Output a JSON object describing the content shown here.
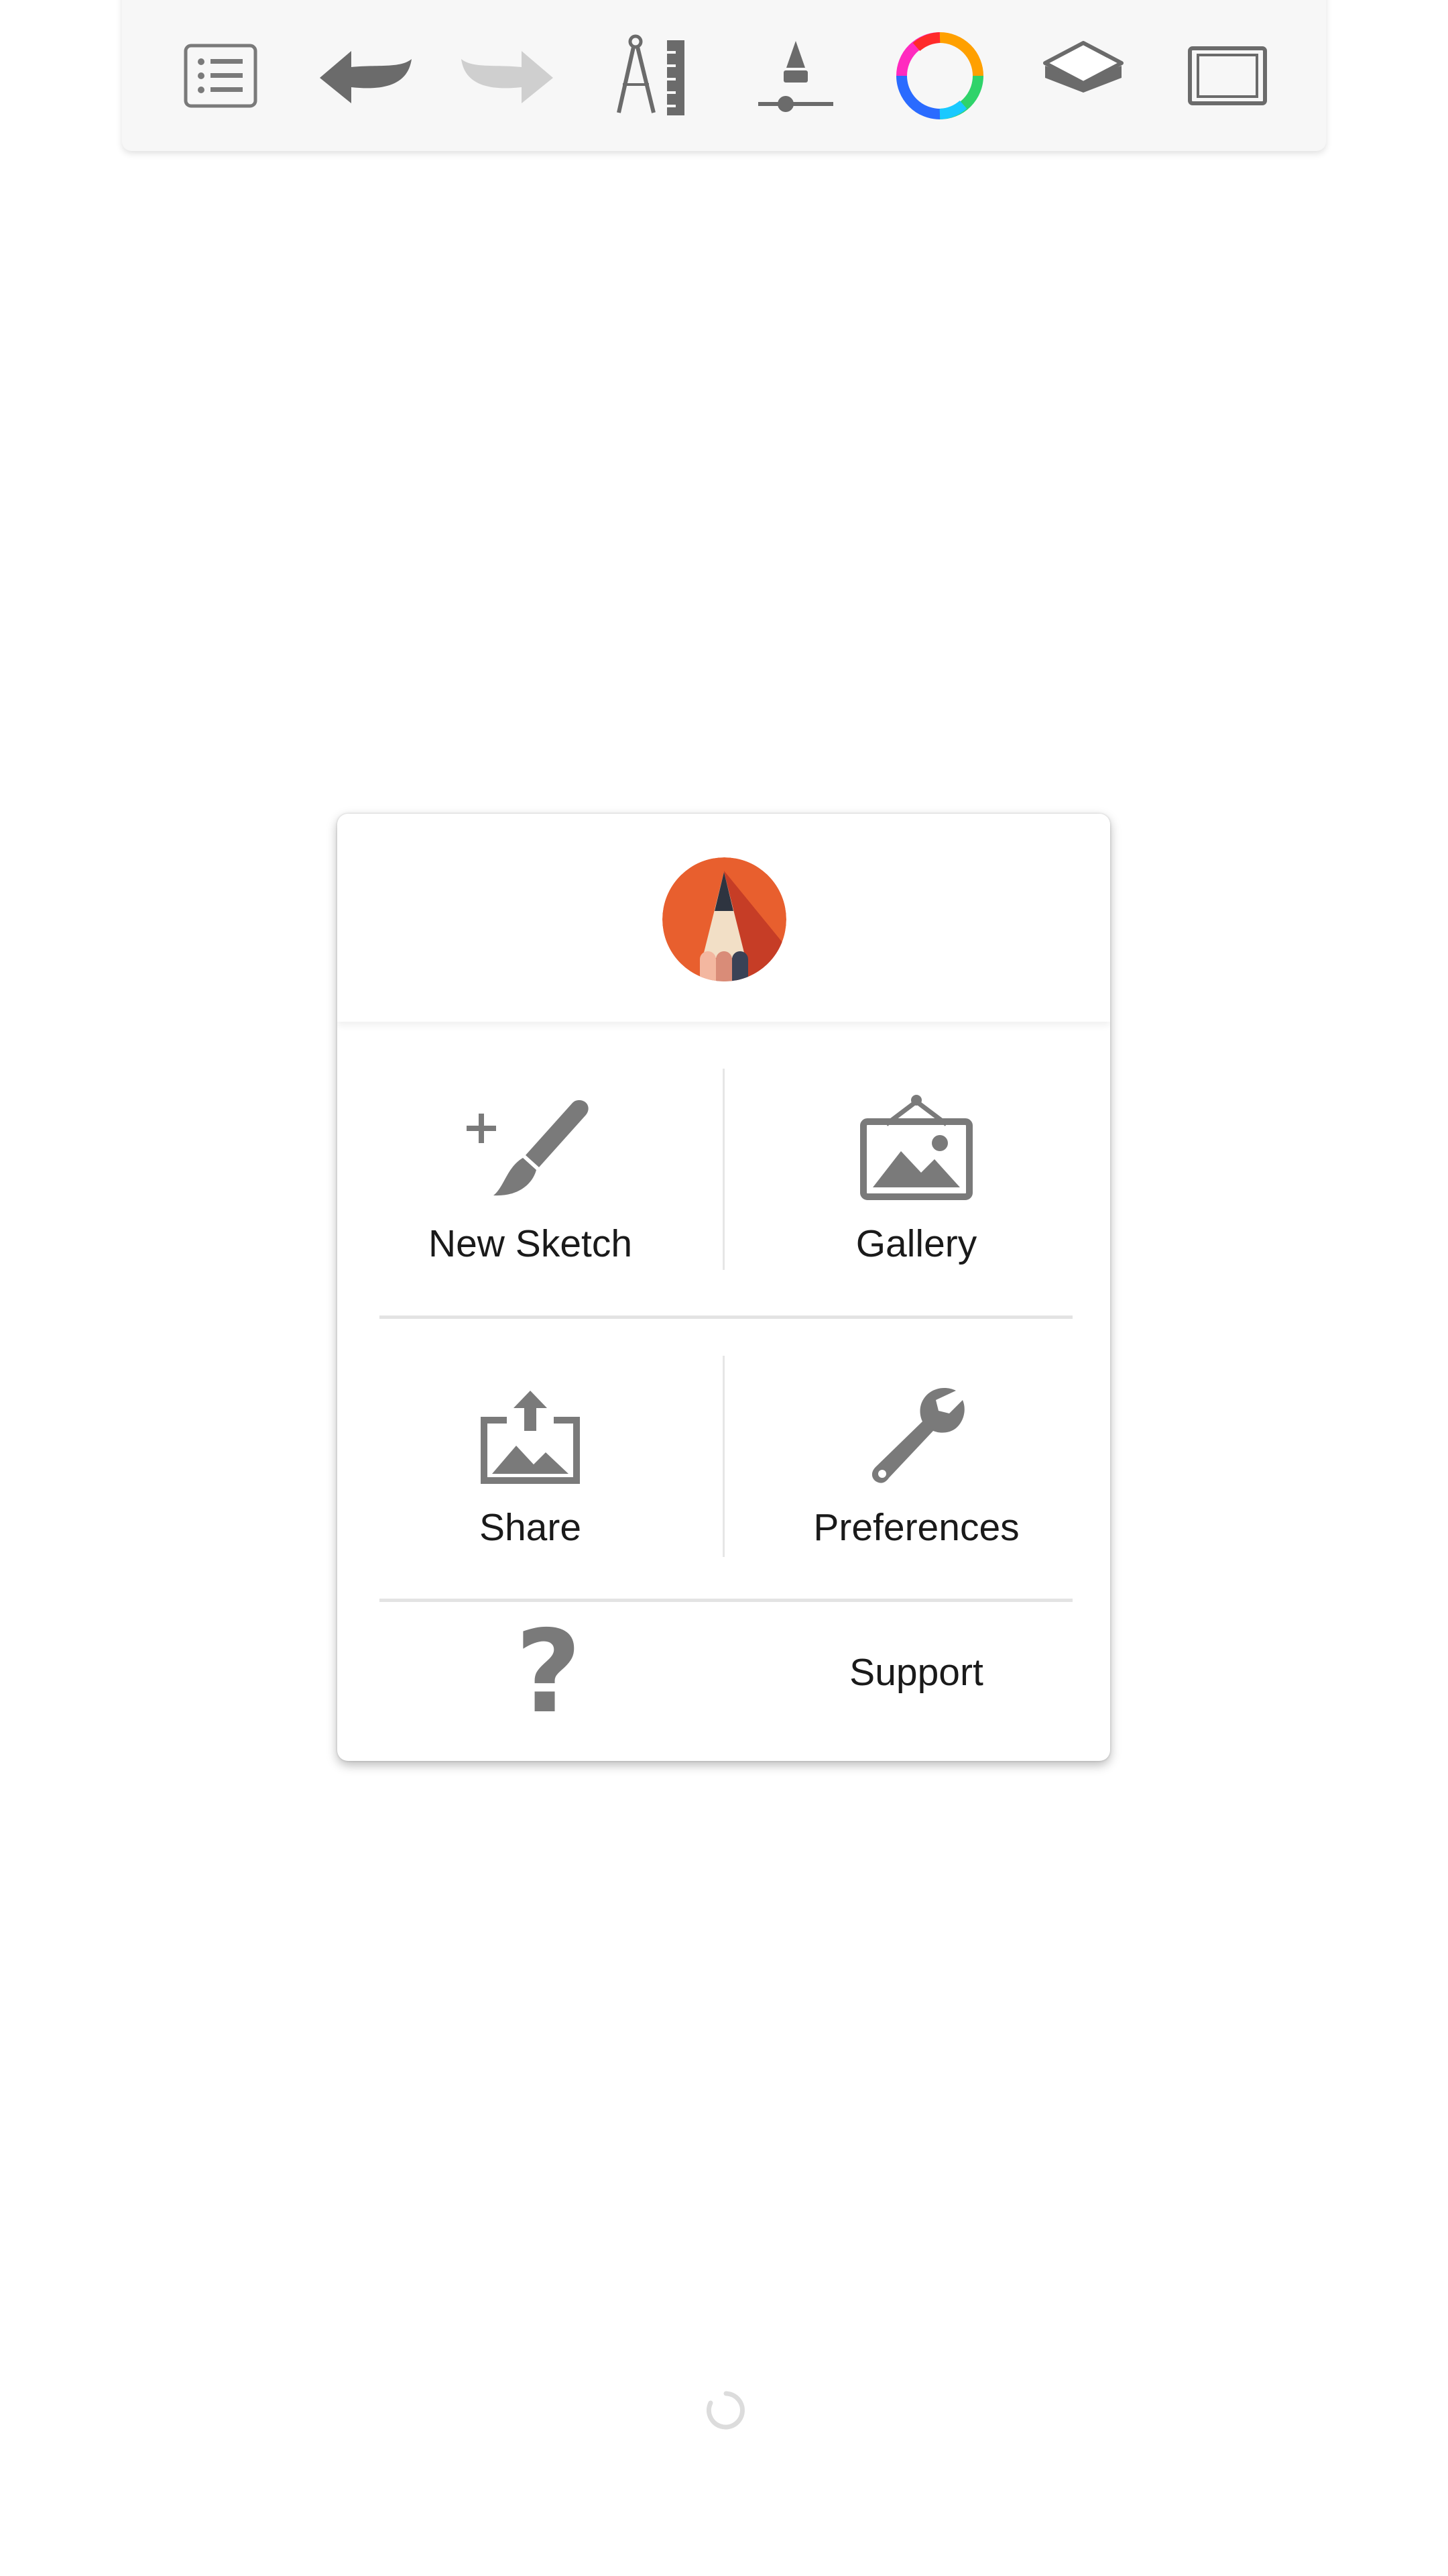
{
  "toolbar": {
    "tools": [
      {
        "icon": "list-icon"
      },
      {
        "icon": "undo-icon"
      },
      {
        "icon": "redo-icon"
      },
      {
        "icon": "ruler-compass-icon"
      },
      {
        "icon": "brush-size-icon"
      },
      {
        "icon": "color-wheel-icon"
      },
      {
        "icon": "layers-icon"
      },
      {
        "icon": "canvas-frame-icon"
      }
    ]
  },
  "menu": {
    "logo": "sketchbook-logo",
    "new_sketch_label": "New Sketch",
    "gallery_label": "Gallery",
    "share_label": "Share",
    "preferences_label": "Preferences",
    "support_label": "Support",
    "support_icon_glyph": "?"
  },
  "colors": {
    "icon_gray": "#7a7a7a",
    "icon_dark": "#6b6b6b",
    "icon_light": "#c8c8c8",
    "logo_orange": "#e85f2e"
  }
}
